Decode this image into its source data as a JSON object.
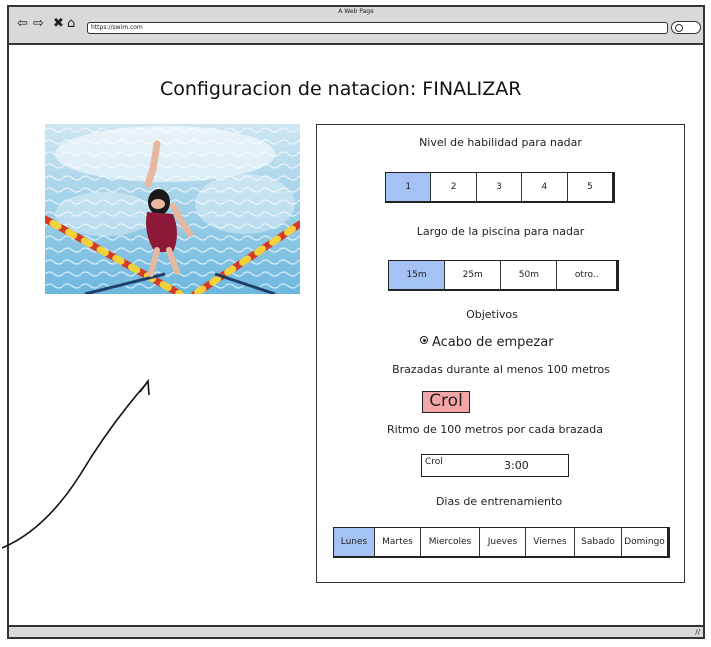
{
  "window": {
    "title": "A Web Page",
    "url": "https://swim.com"
  },
  "nav_icons": [
    "back-icon",
    "forward-icon",
    "close-icon",
    "home-icon"
  ],
  "page": {
    "title": "Configuracion de natacion: FINALIZAR"
  },
  "skill": {
    "label": "Nivel de habilidad para nadar",
    "options": [
      "1",
      "2",
      "3",
      "4",
      "5"
    ],
    "selected": "1"
  },
  "pool": {
    "label": "Largo de la piscina para nadar",
    "options": [
      "15m",
      "25m",
      "50m",
      "otro.."
    ],
    "selected": "15m"
  },
  "goals": {
    "label": "Objetivos",
    "option": "Acabo de empezar"
  },
  "strokes": {
    "label": "Brazadas durante al menos 100 metros",
    "button": "Crol"
  },
  "pace": {
    "label": "Ritmo de 100 metros por cada brazada",
    "stroke": "Crol",
    "time": "3:00"
  },
  "training_days": {
    "label": "Dias de entrenamiento",
    "options": [
      "Lunes",
      "Martes",
      "Miercoles",
      "Jueves",
      "Viernes",
      "Sabado",
      "Domingo"
    ],
    "selected": "Lunes"
  },
  "colors": {
    "selected": "#a4c2f4",
    "accent_button": "#f4a6a6",
    "chrome": "#d9d9d9"
  }
}
